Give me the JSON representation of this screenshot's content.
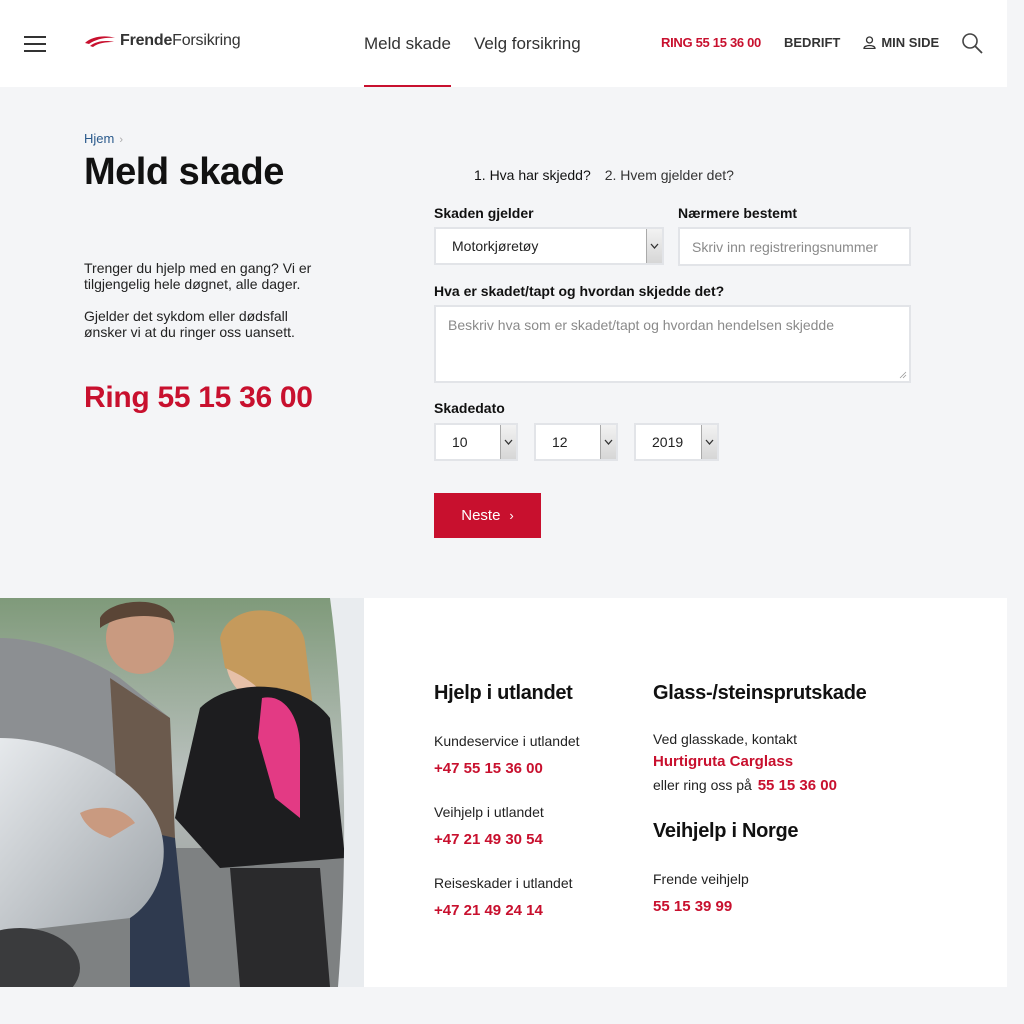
{
  "header": {
    "logo_bold": "Frende",
    "logo_regular": "Forsikring",
    "nav": [
      "Meld skade",
      "Velg forsikring"
    ],
    "phone": "RING 55 15 36 00",
    "corporate": "BEDRIFT",
    "my_page": "MIN SIDE"
  },
  "hero": {
    "breadcrumb": "Hjem",
    "title": "Meld skade",
    "intro_1": "Trenger du hjelp med en gang? Vi er tilgjengelig hele døgnet, alle dager.",
    "intro_2": "Gjelder det sykdom eller dødsfall ønsker vi at du ringer oss uansett.",
    "phone": "Ring 55 15 36 00"
  },
  "form": {
    "step_1": "1. Hva har skjedd?",
    "step_2": "2. Hvem gjelder det?",
    "damage_type_label": "Skaden gjelder",
    "damage_type_value": "Motorkjøretøy",
    "detail_label": "Nærmere bestemt",
    "detail_placeholder": "Skriv inn registreringsnummer",
    "description_label": "Hva er skadet/tapt og hvordan skjedde det?",
    "description_placeholder": "Beskriv hva som er skadet/tapt og hvordan hendelsen skjedde",
    "date_label": "Skadedato",
    "day": "10",
    "month": "12",
    "year": "2019",
    "next_button": "Neste",
    "next_chevron": "›"
  },
  "info": {
    "abroad_title": "Hjelp i utlandet",
    "abroad_items": [
      {
        "label": "Kundeservice i utlandet",
        "phone": "+47 55 15 36 00"
      },
      {
        "label": "Veihjelp i utlandet",
        "phone": "+47 21 49 30 54"
      },
      {
        "label": "Reiseskader i utlandet",
        "phone": "+47 21 49 24 14"
      }
    ],
    "glass_title": "Glass-/steinsprutskade",
    "glass_text": "Ved glasskade, kontakt",
    "glass_link": "Hurtigruta Carglass",
    "glass_or": "eller ring oss på",
    "glass_phone": "55 15 36 00",
    "roadside_title": "Veihjelp i Norge",
    "roadside_label": "Frende veihjelp",
    "roadside_phone": "55 15 39 99"
  },
  "colors": {
    "accent": "#c8102e",
    "background": "#f4f5f7",
    "link": "#2a5a8c"
  }
}
